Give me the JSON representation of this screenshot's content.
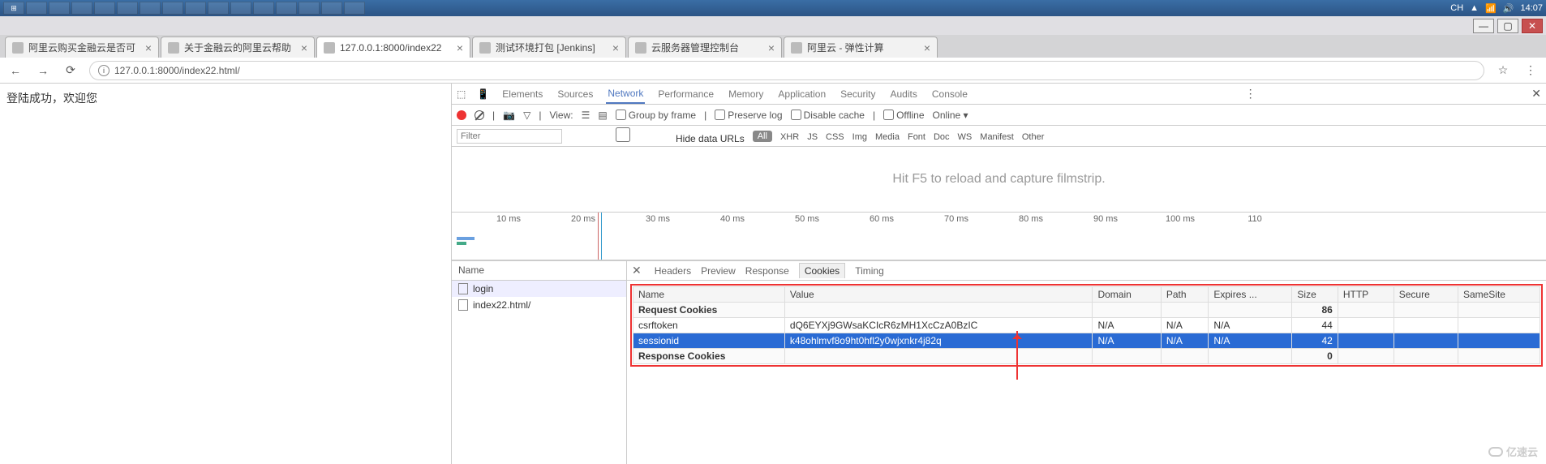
{
  "taskbar": {
    "time": "14:07"
  },
  "window_controls": {
    "min": "—",
    "max": "▢",
    "close": "✕"
  },
  "tabs": [
    {
      "title": "阿里云购买金融云是否可",
      "active": false
    },
    {
      "title": "关于金融云的阿里云帮助",
      "active": false
    },
    {
      "title": "127.0.0.1:8000/index22",
      "active": true
    },
    {
      "title": "测试环境打包 [Jenkins]",
      "active": false
    },
    {
      "title": "云服务器管理控制台",
      "active": false
    },
    {
      "title": "阿里云 - 弹性计算",
      "active": false
    }
  ],
  "address": {
    "url": "127.0.0.1:8000/index22.html/",
    "star": "☆"
  },
  "page_content": "登陆成功，欢迎您",
  "devtools": {
    "tabs": [
      "Elements",
      "Sources",
      "Network",
      "Performance",
      "Memory",
      "Application",
      "Security",
      "Audits",
      "Console"
    ],
    "active_tab": "Network",
    "toolbar": {
      "view": "View:",
      "group_by_frame": "Group by frame",
      "preserve_log": "Preserve log",
      "disable_cache": "Disable cache",
      "offline": "Offline",
      "online": "Online"
    },
    "filter": {
      "placeholder": "Filter",
      "hide_data": "Hide data URLs",
      "all": "All",
      "types": [
        "XHR",
        "JS",
        "CSS",
        "Img",
        "Media",
        "Font",
        "Doc",
        "WS",
        "Manifest",
        "Other"
      ]
    },
    "hint": "Hit F5 to reload and capture filmstrip.",
    "timeline": {
      "ticks": [
        "10 ms",
        "20 ms",
        "30 ms",
        "40 ms",
        "50 ms",
        "60 ms",
        "70 ms",
        "80 ms",
        "90 ms",
        "100 ms",
        "110"
      ]
    },
    "names": {
      "header": "Name",
      "items": [
        "login",
        "index22.html/"
      ]
    },
    "detail_tabs": [
      "Headers",
      "Preview",
      "Response",
      "Cookies",
      "Timing"
    ],
    "active_detail": "Cookies",
    "cookies": {
      "columns": [
        "Name",
        "Value",
        "Domain",
        "Path",
        "Expires ...",
        "Size",
        "HTTP",
        "Secure",
        "SameSite"
      ],
      "section_req": "Request Cookies",
      "req_size": "86",
      "rows": [
        {
          "name": "csrftoken",
          "value": "dQ6EYXj9GWsaKCIcR6zMH1XcCzA0BzIC",
          "domain": "N/A",
          "path": "N/A",
          "expires": "N/A",
          "size": "44",
          "sel": false
        },
        {
          "name": "sessionid",
          "value": "k48ohlmvf8o9ht0hfl2y0wjxnkr4j82q",
          "domain": "N/A",
          "path": "N/A",
          "expires": "N/A",
          "size": "42",
          "sel": true
        }
      ],
      "section_res": "Response Cookies",
      "res_size": "0"
    }
  },
  "watermark": "亿速云"
}
